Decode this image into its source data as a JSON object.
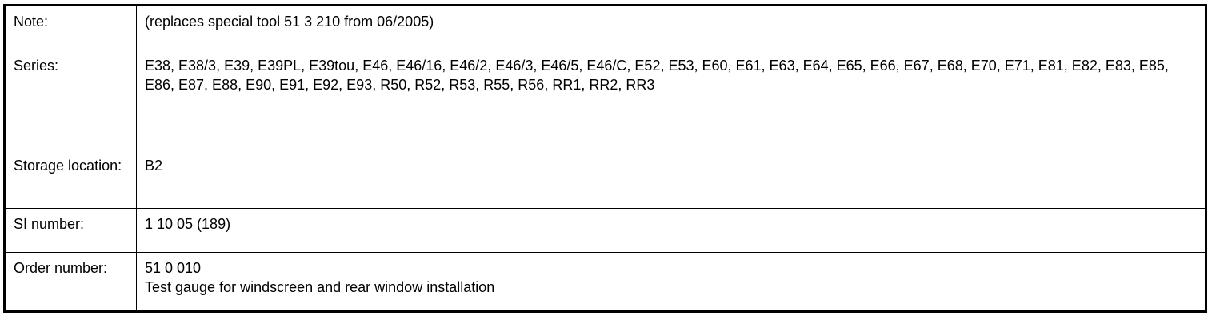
{
  "rows": [
    {
      "label": "Note:",
      "value": [
        "(replaces special tool 51 3 210 from 06/2005)"
      ]
    },
    {
      "label": "Series:",
      "value": [
        "E38, E38/3, E39, E39PL, E39tou, E46, E46/16, E46/2, E46/3, E46/5, E46/C, E52, E53, E60, E61, E63, E64, E65, E66, E67, E68, E70, E71, E81, E82, E83, E85, E86, E87, E88, E90, E91, E92, E93, R50, R52, R53, R55, R56, RR1, RR2, RR3"
      ]
    },
    {
      "label": "Storage location:",
      "value": [
        "B2"
      ]
    },
    {
      "label": "SI number:",
      "value": [
        "1 10 05 (189)"
      ]
    },
    {
      "label": "Order number:",
      "value": [
        "51 0 010",
        "Test gauge for windscreen and rear window installation"
      ]
    }
  ]
}
